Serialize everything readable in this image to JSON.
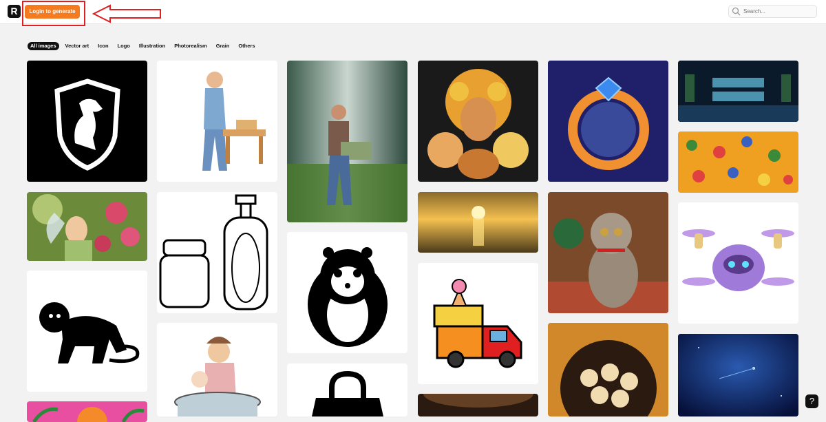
{
  "app": {
    "logo_letter": "R"
  },
  "header": {
    "login_label": "Login to generate",
    "search_placeholder": "Search..."
  },
  "filters": [
    "All images",
    "Vector art",
    "Icon",
    "Logo",
    "Illustration",
    "Photorealism",
    "Grain",
    "Others"
  ],
  "active_filter": "All images",
  "gallery": [
    {
      "col": 1,
      "items": [
        "white horse shield logo on black",
        "fairy smelling roses in garden",
        "black monkey silhouette icon",
        "palm trees sunset vector art"
      ]
    },
    {
      "col": 2,
      "items": [
        "carpenter working at bench illustration",
        "jar and bottle line art",
        "mother bathing baby illustration"
      ]
    },
    {
      "col": 3,
      "items": [
        "man with laptop motion blur office",
        "hamster black and white vector",
        "black handbag icon"
      ]
    },
    {
      "col": 4,
      "items": [
        "pasta sheep creatures",
        "golden sunset over sea waves",
        "ice cream truck icon",
        "dark amber scene"
      ]
    },
    {
      "col": 5,
      "items": [
        "glowing ring with blue gem",
        "tabby cat sitting on rug",
        "dumplings bowl on wooden table"
      ]
    },
    {
      "col": 6,
      "items": [
        "Asian World neon sign",
        "colorful gems pattern on orange",
        "purple drone robot 3D",
        "blue space nebula"
      ]
    }
  ],
  "help": {
    "label": "?"
  },
  "colors": {
    "accent": "#f47b20",
    "annotation": "#e02020"
  }
}
